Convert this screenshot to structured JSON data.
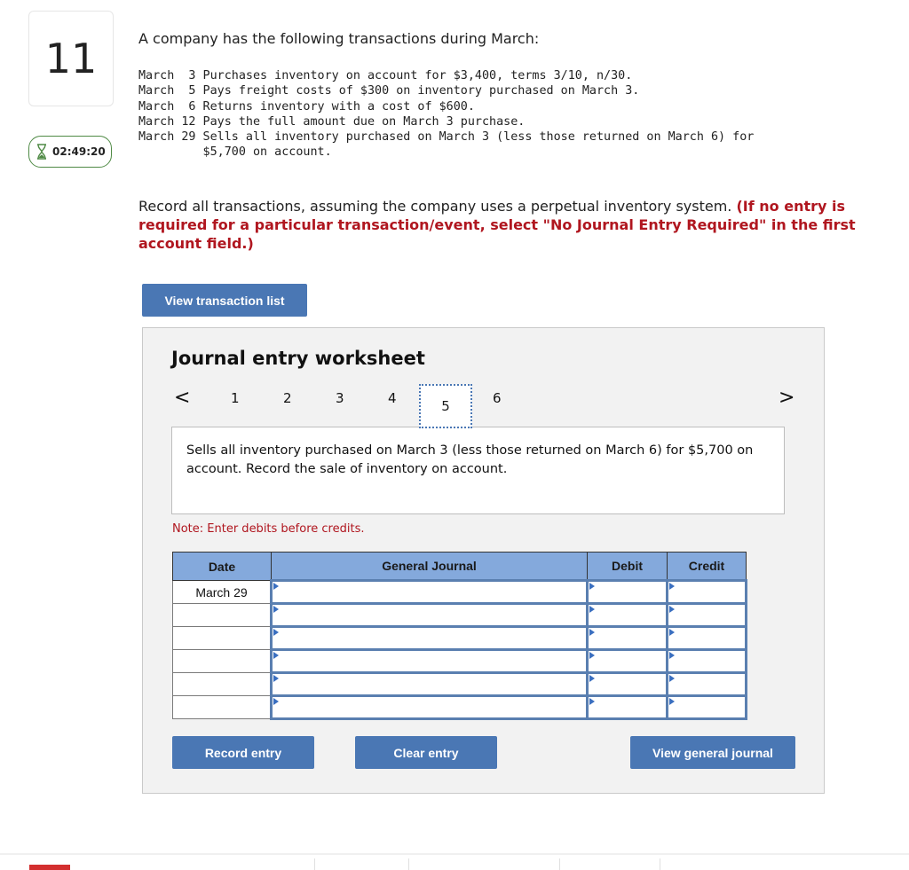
{
  "question": {
    "number": "11",
    "timer": "02:49:20"
  },
  "problem": {
    "intro": "A company has the following transactions during March:",
    "transactions": [
      "March  3 Purchases inventory on account for $3,400, terms 3/10, n/30.",
      "March  5 Pays freight costs of $300 on inventory purchased on March 3.",
      "March  6 Returns inventory with a cost of $600.",
      "March 12 Pays the full amount due on March 3 purchase.",
      "March 29 Sells all inventory purchased on March 3 (less those returned on March 6) for",
      "         $5,700 on account."
    ],
    "instruction": "Record all transactions, assuming the company uses a perpetual inventory system.",
    "instruction_note": "(If no entry is required for a particular transaction/event, select \"No Journal Entry Required\" in the first account field.)"
  },
  "buttons": {
    "view_transaction_list": "View transaction list",
    "record_entry": "Record entry",
    "clear_entry": "Clear entry",
    "view_general_journal": "View general journal"
  },
  "worksheet": {
    "title": "Journal entry worksheet",
    "prev": "<",
    "next": ">",
    "pages": [
      "1",
      "2",
      "3",
      "4",
      "5",
      "6"
    ],
    "active_page": "5",
    "description": "Sells all inventory purchased on March 3 (less those returned on March 6) for $5,700 on account. Record the sale of inventory on account.",
    "note": "Note: Enter debits before credits.",
    "table": {
      "headers": [
        "Date",
        "General Journal",
        "Debit",
        "Credit"
      ],
      "rows": [
        {
          "date": "March 29",
          "account": "",
          "debit": "",
          "credit": ""
        },
        {
          "date": "",
          "account": "",
          "debit": "",
          "credit": ""
        },
        {
          "date": "",
          "account": "",
          "debit": "",
          "credit": ""
        },
        {
          "date": "",
          "account": "",
          "debit": "",
          "credit": ""
        },
        {
          "date": "",
          "account": "",
          "debit": "",
          "credit": ""
        },
        {
          "date": "",
          "account": "",
          "debit": "",
          "credit": ""
        }
      ]
    }
  }
}
